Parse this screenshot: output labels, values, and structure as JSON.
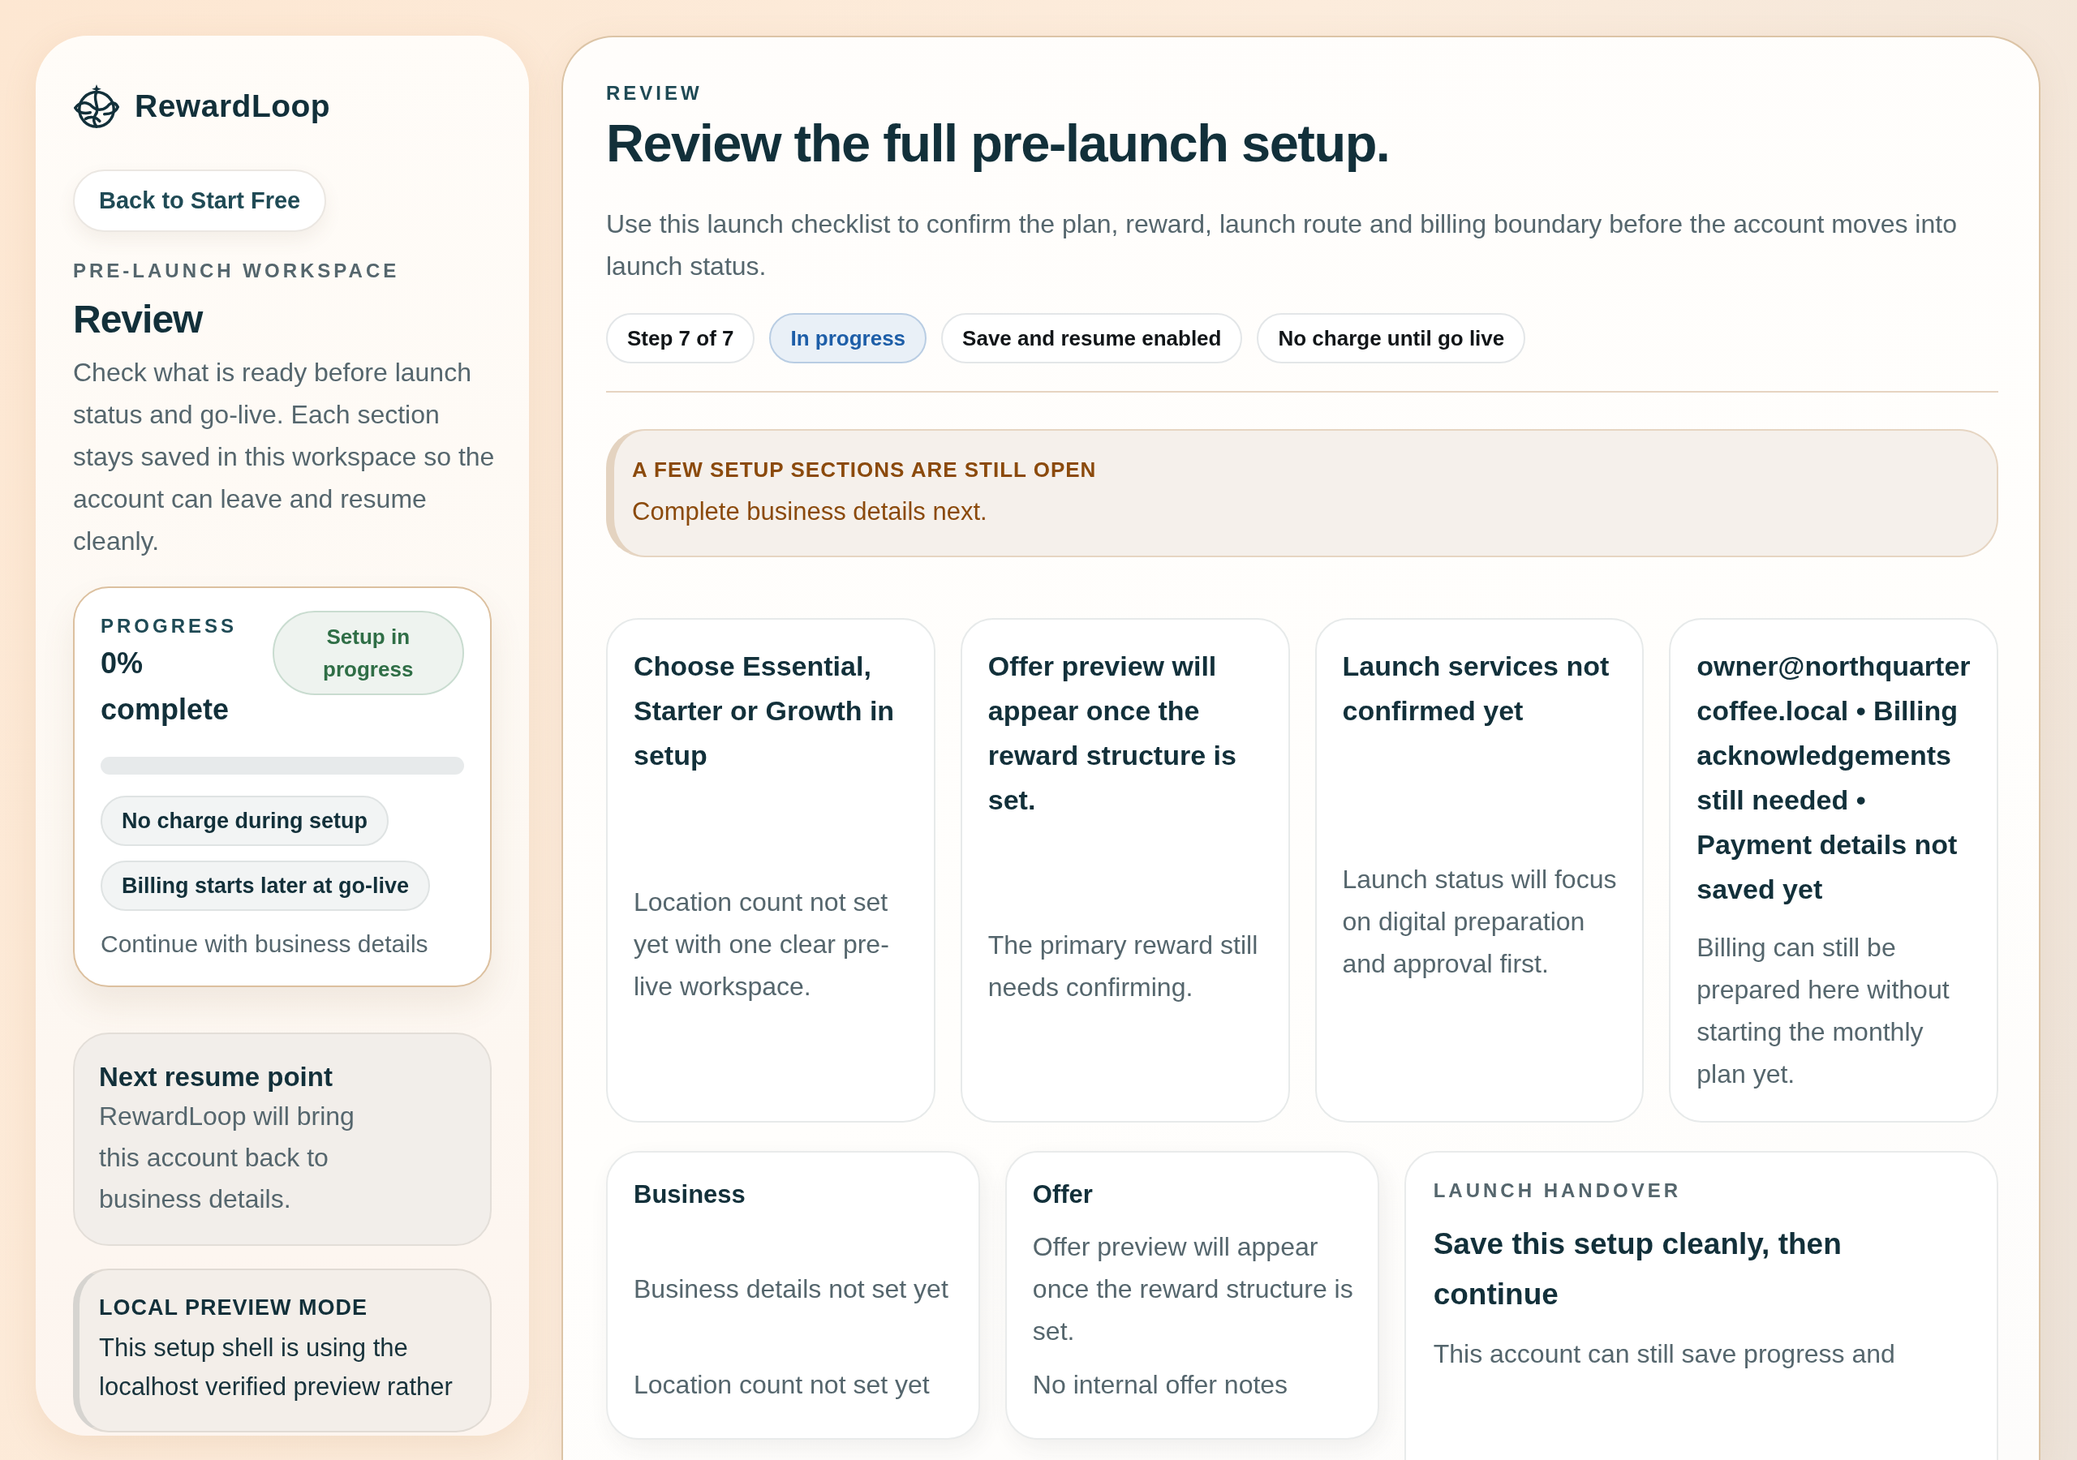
{
  "sidebar": {
    "brand": "RewardLoop",
    "back_button": "Back to Start Free",
    "eyebrow": "PRE-LAUNCH WORKSPACE",
    "title": "Review",
    "description": "Check what is ready before launch status and go-live. Each section stays saved in this workspace so the account can leave and resume cleanly.",
    "progress": {
      "label": "PROGRESS",
      "value": "0% complete",
      "status": "Setup in progress",
      "level": 0,
      "chips": [
        "No charge during setup",
        "Billing starts later at go-live"
      ],
      "next_step": "Continue with business details"
    },
    "resume": {
      "title": "Next resume point",
      "text": "RewardLoop will bring this account back to business details."
    },
    "notice": {
      "title": "LOCAL PREVIEW MODE",
      "text": "This setup shell is using the localhost verified preview rather"
    }
  },
  "main": {
    "eyebrow": "REVIEW",
    "title": "Review the full pre-launch setup.",
    "description": "Use this launch checklist to confirm the plan, reward, launch route and billing boundary before the account moves into launch status.",
    "badges": [
      {
        "label": "Step 7 of 7",
        "kind": "plain"
      },
      {
        "label": "In progress",
        "kind": "status"
      },
      {
        "label": "Save and resume enabled",
        "kind": "plain"
      },
      {
        "label": "No charge until go live",
        "kind": "plain"
      }
    ],
    "alert": {
      "title": "A FEW SETUP SECTIONS ARE STILL OPEN",
      "text": "Complete business details next."
    },
    "summary_cards": [
      {
        "title": "Choose Essential, Starter or Growth in setup",
        "text": "Location count not set yet with one clear pre-live workspace."
      },
      {
        "title": "Offer preview will appear once the reward structure is set.",
        "text": "The primary reward still needs confirming."
      },
      {
        "title": "Launch services not confirmed yet",
        "text": "Launch status will focus on digital preparation and approval first."
      },
      {
        "title": "owner@northquartercoffee.local • Billing acknowledgements still needed • Payment details not saved yet",
        "text": "Billing can still be prepared here without starting the monthly plan yet."
      }
    ],
    "section_cards": [
      {
        "title": "Business",
        "items": [
          "Business details not set yet",
          "Location count not set yet"
        ]
      },
      {
        "title": "Offer",
        "items": [
          "Offer preview will appear once the reward structure is set.",
          "No internal offer notes"
        ]
      }
    ],
    "handover": {
      "eyebrow": "LAUNCH HANDOVER",
      "title": "Save this setup cleanly, then continue",
      "text": "This account can still save progress and"
    }
  }
}
